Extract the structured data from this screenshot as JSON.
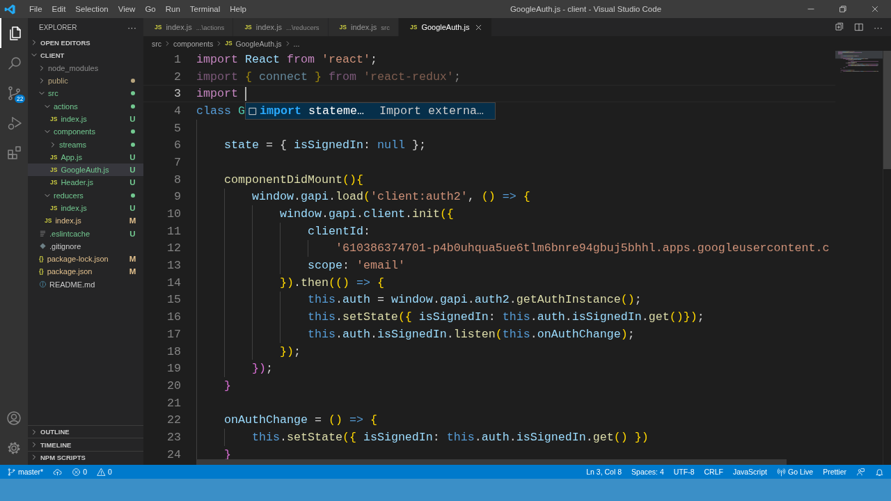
{
  "window": {
    "title": "GoogleAuth.js - client - Visual Studio Code",
    "menu": [
      "File",
      "Edit",
      "Selection",
      "View",
      "Go",
      "Run",
      "Terminal",
      "Help"
    ]
  },
  "activity_bar": {
    "items": [
      {
        "kind": "files",
        "selected": true
      },
      {
        "kind": "search",
        "selected": false
      },
      {
        "kind": "scm",
        "selected": false,
        "badge": "22"
      },
      {
        "kind": "debug",
        "selected": false
      },
      {
        "kind": "extensions",
        "selected": false
      }
    ],
    "bottom": [
      {
        "kind": "account"
      },
      {
        "kind": "settings"
      }
    ]
  },
  "sidebar": {
    "title": "EXPLORER",
    "more": "···",
    "sections": [
      {
        "label": "OPEN EDITORS",
        "expanded": false
      },
      {
        "label": "CLIENT",
        "expanded": true,
        "children": [
          {
            "name": "node_modules",
            "kind": "folder",
            "expanded": false,
            "selected": false,
            "color": "#8c8c8c"
          },
          {
            "name": "public",
            "kind": "folder",
            "expanded": false,
            "selected": false,
            "color": "#b8a57e",
            "dot": true
          },
          {
            "name": "src",
            "kind": "folder",
            "expanded": true,
            "selected": false,
            "color": "#73c991",
            "dot": true,
            "children": [
              {
                "name": "actions",
                "kind": "folder",
                "expanded": true,
                "selected": false,
                "color": "#73c991",
                "dot": true,
                "children": [
                  {
                    "name": "index.js",
                    "kind": "js",
                    "icon_text": "JS",
                    "selected": false,
                    "color": "#73c991",
                    "status": "U"
                  }
                ]
              },
              {
                "name": "components",
                "kind": "folder",
                "expanded": true,
                "selected": false,
                "color": "#73c991",
                "dot": true,
                "children": [
                  {
                    "name": "streams",
                    "kind": "folder",
                    "expanded": false,
                    "selected": false,
                    "color": "#73c991",
                    "dot": true
                  },
                  {
                    "name": "App.js",
                    "kind": "js",
                    "icon_text": "JS",
                    "selected": false,
                    "color": "#73c991",
                    "status": "U"
                  },
                  {
                    "name": "GoogleAuth.js",
                    "kind": "js",
                    "icon_text": "JS",
                    "selected": true,
                    "color": "#73c991",
                    "status": "U"
                  },
                  {
                    "name": "Header.js",
                    "kind": "js",
                    "icon_text": "JS",
                    "selected": false,
                    "color": "#73c991",
                    "status": "U"
                  }
                ]
              },
              {
                "name": "reducers",
                "kind": "folder",
                "expanded": true,
                "selected": false,
                "color": "#73c991",
                "dot": true,
                "children": [
                  {
                    "name": "index.js",
                    "kind": "js",
                    "icon_text": "JS",
                    "selected": false,
                    "color": "#73c991",
                    "status": "U"
                  }
                ]
              },
              {
                "name": "index.js",
                "kind": "js",
                "icon_text": "JS",
                "selected": false,
                "color": "#e2c08d",
                "status": "M"
              }
            ]
          },
          {
            "name": ".eslintcache",
            "kind": "lines",
            "selected": false,
            "color": "#73c991",
            "status": "U"
          },
          {
            "name": ".gitignore",
            "kind": "tag",
            "selected": false,
            "color": "#cccccc"
          },
          {
            "name": "package-lock.json",
            "kind": "json",
            "icon_text": "{}",
            "selected": false,
            "color": "#e2c08d",
            "status": "M"
          },
          {
            "name": "package.json",
            "kind": "json",
            "icon_text": "{}",
            "selected": false,
            "color": "#e2c08d",
            "status": "M"
          },
          {
            "name": "README.md",
            "kind": "info",
            "selected": false,
            "color": "#cccccc"
          }
        ]
      }
    ],
    "bottom_sections": [
      {
        "label": "OUTLINE",
        "expanded": false
      },
      {
        "label": "TIMELINE",
        "expanded": false
      },
      {
        "label": "NPM SCRIPTS",
        "expanded": false
      }
    ]
  },
  "tabs": [
    {
      "icon_text": "JS",
      "label": "index.js",
      "description": "...\\actions",
      "selected": false
    },
    {
      "icon_text": "JS",
      "label": "index.js",
      "description": "...\\reducers",
      "selected": false
    },
    {
      "icon_text": "JS",
      "label": "index.js",
      "description": "src",
      "selected": false
    },
    {
      "icon_text": "JS",
      "label": "GoogleAuth.js",
      "selected": true
    }
  ],
  "tab_actions": {
    "more": "···"
  },
  "breadcrumb": [
    {
      "label": "src"
    },
    {
      "label": "components"
    },
    {
      "label": "GoogleAuth.js",
      "icon_text": "JS"
    },
    {
      "label": "..."
    }
  ],
  "editor": {
    "lines": [
      {
        "number": "1",
        "tokens": [
          {
            "kind": "kw",
            "text": "import "
          },
          {
            "kind": "id",
            "text": "React "
          },
          {
            "kind": "kw",
            "text": "from "
          },
          {
            "kind": "str",
            "text": "'react'"
          },
          {
            "kind": "p",
            "text": ";"
          }
        ]
      },
      {
        "number": "2",
        "faded": true,
        "tokens": [
          {
            "kind": "kw",
            "text": "import "
          },
          {
            "kind": "b1",
            "text": "{"
          },
          {
            "kind": "id",
            "text": " connect "
          },
          {
            "kind": "b1",
            "text": "}"
          },
          {
            "kind": "kw",
            "text": " from "
          },
          {
            "kind": "str",
            "text": "'react-redux'"
          },
          {
            "kind": "p",
            "text": ";"
          }
        ]
      },
      {
        "number": "3",
        "current": true,
        "cursor": true,
        "tokens": [
          {
            "kind": "kw",
            "text": "import "
          }
        ]
      },
      {
        "number": "4",
        "tokens": [
          {
            "kind": "cls",
            "text": "class "
          },
          {
            "kind": "type",
            "text": "G"
          }
        ],
        "children": [
          {
            "number": "5"
          },
          {
            "number": "6",
            "tokens": [
              {
                "kind": "id",
                "text": "state"
              },
              {
                "kind": "p",
                "text": " = { "
              },
              {
                "kind": "id",
                "text": "isSignedIn"
              },
              {
                "kind": "p",
                "text": ": "
              },
              {
                "kind": "cls",
                "text": "null"
              },
              {
                "kind": "p",
                "text": " };"
              }
            ]
          },
          {
            "number": "7"
          },
          {
            "number": "8",
            "tokens": [
              {
                "kind": "fn",
                "text": "componentDidMount"
              },
              {
                "kind": "b1",
                "text": "(){"
              }
            ],
            "children": [
              {
                "number": "9",
                "tokens": [
                  {
                    "kind": "id",
                    "text": "window"
                  },
                  {
                    "kind": "p",
                    "text": "."
                  },
                  {
                    "kind": "id",
                    "text": "gapi"
                  },
                  {
                    "kind": "p",
                    "text": "."
                  },
                  {
                    "kind": "fn",
                    "text": "load"
                  },
                  {
                    "kind": "b1",
                    "text": "("
                  },
                  {
                    "kind": "str",
                    "text": "'client:auth2'"
                  },
                  {
                    "kind": "p",
                    "text": ", "
                  },
                  {
                    "kind": "b1",
                    "text": "()"
                  },
                  {
                    "kind": "cls",
                    "text": " => "
                  },
                  {
                    "kind": "b1",
                    "text": "{"
                  }
                ],
                "children": [
                  {
                    "number": "10",
                    "tokens": [
                      {
                        "kind": "id",
                        "text": "window"
                      },
                      {
                        "kind": "p",
                        "text": "."
                      },
                      {
                        "kind": "id",
                        "text": "gapi"
                      },
                      {
                        "kind": "p",
                        "text": "."
                      },
                      {
                        "kind": "id",
                        "text": "client"
                      },
                      {
                        "kind": "p",
                        "text": "."
                      },
                      {
                        "kind": "fn",
                        "text": "init"
                      },
                      {
                        "kind": "b1",
                        "text": "({"
                      }
                    ],
                    "children": [
                      {
                        "number": "11",
                        "tokens": [
                          {
                            "kind": "id",
                            "text": "clientId"
                          },
                          {
                            "kind": "p",
                            "text": ":"
                          }
                        ],
                        "children": [
                          {
                            "number": "12",
                            "tokens": [
                              {
                                "kind": "str",
                                "text": "'610386374701-p4b0uhqua5ue6tlm6bnre94gbuj5bhhl.apps.googleusercontent.c"
                              }
                            ]
                          }
                        ]
                      },
                      {
                        "number": "13",
                        "tokens": [
                          {
                            "kind": "id",
                            "text": "scope"
                          },
                          {
                            "kind": "p",
                            "text": ": "
                          },
                          {
                            "kind": "str",
                            "text": "'email'"
                          }
                        ]
                      }
                    ]
                  },
                  {
                    "number": "14",
                    "tokens": [
                      {
                        "kind": "b1",
                        "text": "})"
                      },
                      {
                        "kind": "p",
                        "text": "."
                      },
                      {
                        "kind": "fn",
                        "text": "then"
                      },
                      {
                        "kind": "b1",
                        "text": "(()"
                      },
                      {
                        "kind": "cls",
                        "text": " => "
                      },
                      {
                        "kind": "b1",
                        "text": "{"
                      }
                    ],
                    "children": [
                      {
                        "number": "15",
                        "tokens": [
                          {
                            "kind": "cls",
                            "text": "this"
                          },
                          {
                            "kind": "p",
                            "text": "."
                          },
                          {
                            "kind": "id",
                            "text": "auth"
                          },
                          {
                            "kind": "p",
                            "text": " = "
                          },
                          {
                            "kind": "id",
                            "text": "window"
                          },
                          {
                            "kind": "p",
                            "text": "."
                          },
                          {
                            "kind": "id",
                            "text": "gapi"
                          },
                          {
                            "kind": "p",
                            "text": "."
                          },
                          {
                            "kind": "id",
                            "text": "auth2"
                          },
                          {
                            "kind": "p",
                            "text": "."
                          },
                          {
                            "kind": "fn",
                            "text": "getAuthInstance"
                          },
                          {
                            "kind": "b1",
                            "text": "()"
                          },
                          {
                            "kind": "p",
                            "text": ";"
                          }
                        ]
                      },
                      {
                        "number": "16",
                        "tokens": [
                          {
                            "kind": "cls",
                            "text": "this"
                          },
                          {
                            "kind": "p",
                            "text": "."
                          },
                          {
                            "kind": "fn",
                            "text": "setState"
                          },
                          {
                            "kind": "b1",
                            "text": "({"
                          },
                          {
                            "kind": "id",
                            "text": " isSignedIn"
                          },
                          {
                            "kind": "p",
                            "text": ": "
                          },
                          {
                            "kind": "cls",
                            "text": "this"
                          },
                          {
                            "kind": "p",
                            "text": "."
                          },
                          {
                            "kind": "id",
                            "text": "auth"
                          },
                          {
                            "kind": "p",
                            "text": "."
                          },
                          {
                            "kind": "id",
                            "text": "isSignedIn"
                          },
                          {
                            "kind": "p",
                            "text": "."
                          },
                          {
                            "kind": "fn",
                            "text": "get"
                          },
                          {
                            "kind": "b1",
                            "text": "()})"
                          },
                          {
                            "kind": "p",
                            "text": ";"
                          }
                        ]
                      },
                      {
                        "number": "17",
                        "tokens": [
                          {
                            "kind": "cls",
                            "text": "this"
                          },
                          {
                            "kind": "p",
                            "text": "."
                          },
                          {
                            "kind": "id",
                            "text": "auth"
                          },
                          {
                            "kind": "p",
                            "text": "."
                          },
                          {
                            "kind": "id",
                            "text": "isSignedIn"
                          },
                          {
                            "kind": "p",
                            "text": "."
                          },
                          {
                            "kind": "fn",
                            "text": "listen"
                          },
                          {
                            "kind": "b1",
                            "text": "("
                          },
                          {
                            "kind": "cls",
                            "text": "this"
                          },
                          {
                            "kind": "p",
                            "text": "."
                          },
                          {
                            "kind": "id",
                            "text": "onAuthChange"
                          },
                          {
                            "kind": "b1",
                            "text": ")"
                          },
                          {
                            "kind": "p",
                            "text": ";"
                          }
                        ]
                      }
                    ]
                  },
                  {
                    "number": "18",
                    "tokens": [
                      {
                        "kind": "b1",
                        "text": "})"
                      },
                      {
                        "kind": "p",
                        "text": ";"
                      }
                    ]
                  }
                ]
              },
              {
                "number": "19",
                "tokens": [
                  {
                    "kind": "b2",
                    "text": "})"
                  },
                  {
                    "kind": "p",
                    "text": ";"
                  }
                ]
              }
            ]
          },
          {
            "number": "20",
            "tokens": [
              {
                "kind": "b2",
                "text": "}"
              }
            ]
          },
          {
            "number": "21"
          },
          {
            "number": "22",
            "tokens": [
              {
                "kind": "id",
                "text": "onAuthChange"
              },
              {
                "kind": "p",
                "text": " = "
              },
              {
                "kind": "b1",
                "text": "()"
              },
              {
                "kind": "cls",
                "text": " => "
              },
              {
                "kind": "b1",
                "text": "{"
              }
            ],
            "children": [
              {
                "number": "23",
                "tokens": [
                  {
                    "kind": "cls",
                    "text": "this"
                  },
                  {
                    "kind": "p",
                    "text": "."
                  },
                  {
                    "kind": "fn",
                    "text": "setState"
                  },
                  {
                    "kind": "b1",
                    "text": "({"
                  },
                  {
                    "kind": "id",
                    "text": " isSignedIn"
                  },
                  {
                    "kind": "p",
                    "text": ": "
                  },
                  {
                    "kind": "cls",
                    "text": "this"
                  },
                  {
                    "kind": "p",
                    "text": "."
                  },
                  {
                    "kind": "id",
                    "text": "auth"
                  },
                  {
                    "kind": "p",
                    "text": "."
                  },
                  {
                    "kind": "id",
                    "text": "isSignedIn"
                  },
                  {
                    "kind": "p",
                    "text": "."
                  },
                  {
                    "kind": "fn",
                    "text": "get"
                  },
                  {
                    "kind": "b1",
                    "text": "()"
                  },
                  {
                    "kind": "b1",
                    "text": " })"
                  }
                ]
              }
            ]
          },
          {
            "number": "24",
            "tokens": [
              {
                "kind": "b2",
                "text": "}"
              }
            ]
          }
        ]
      }
    ],
    "suggestion": {
      "match": "import",
      "label": " stateme…",
      "detail": "Import externa…"
    }
  },
  "status_bar": {
    "left": [
      {
        "kind": "branch",
        "text": "master*"
      },
      {
        "kind": "sync"
      },
      {
        "kind": "error",
        "text": "0"
      },
      {
        "kind": "warning",
        "text": "0"
      }
    ],
    "right": [
      {
        "kind": "text",
        "text": "Ln 3, Col 8"
      },
      {
        "kind": "text",
        "text": "Spaces: 4"
      },
      {
        "kind": "text",
        "text": "UTF-8"
      },
      {
        "kind": "text",
        "text": "CRLF"
      },
      {
        "kind": "text",
        "text": "JavaScript"
      },
      {
        "kind": "broadcast",
        "text": "Go Live"
      },
      {
        "kind": "text",
        "text": "Prettier"
      },
      {
        "kind": "feedback"
      },
      {
        "kind": "bell"
      }
    ]
  }
}
